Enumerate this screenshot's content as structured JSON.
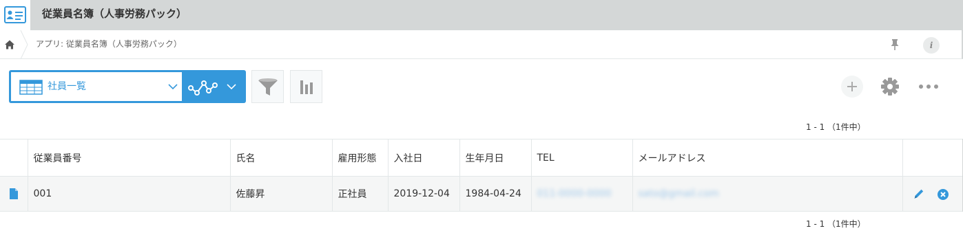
{
  "app": {
    "title": "従業員名簿（人事労務パック）",
    "icon": "employee-card-icon"
  },
  "breadcrumb": {
    "home_icon": "home-icon",
    "text": "アプリ: 従業員名簿（人事労務パック）"
  },
  "header_actions": {
    "pin_icon": "pin-icon",
    "info_label": "i"
  },
  "toolbar": {
    "view_icon": "table-view-icon",
    "view_name": "社員一覧",
    "graph_icon": "graph-icon",
    "filter_icon": "filter-icon",
    "chart_icon": "bar-chart-icon",
    "add_icon": "plus-icon",
    "settings_icon": "gear-icon",
    "more_icon": "more-icon",
    "accent": "#3498db"
  },
  "pagination": {
    "top": "1 - 1 （1件中）",
    "bottom": "1 - 1 （1件中）"
  },
  "table": {
    "columns": [
      "従業員番号",
      "氏名",
      "雇用形態",
      "入社日",
      "生年月日",
      "TEL",
      "メールアドレス"
    ],
    "rows": [
      {
        "employee_no": "001",
        "name": "佐藤昇",
        "employment_type": "正社員",
        "hire_date": "2019-12-04",
        "birth_date": "1984-04-24",
        "tel": "011-0000-0000",
        "email": "sato@gmail.com"
      }
    ],
    "row_icons": {
      "detail": "document-icon",
      "edit": "pencil-icon",
      "delete": "delete-icon"
    }
  }
}
